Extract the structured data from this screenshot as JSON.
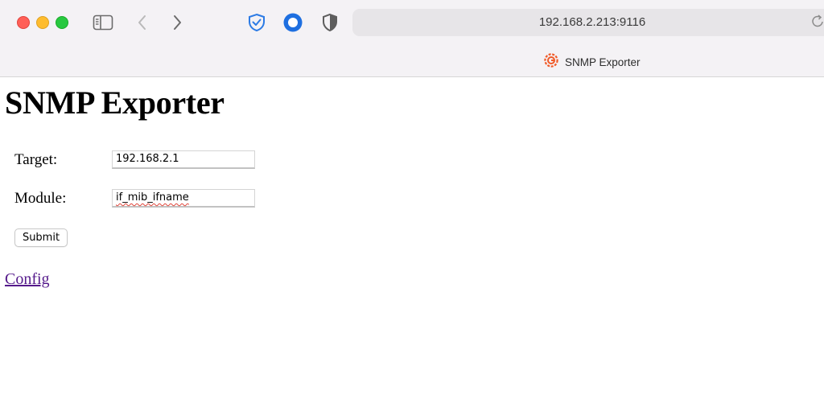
{
  "browser": {
    "url": "192.168.2.213:9116",
    "tab_title": "SNMP Exporter"
  },
  "page": {
    "title": "SNMP Exporter",
    "form": {
      "target_label": "Target:",
      "target_value": "192.168.2.1",
      "module_label": "Module:",
      "module_value": "if_mib_ifname",
      "submit_label": "Submit"
    },
    "config_link": "Config"
  },
  "colors": {
    "link_visited": "#551a8b",
    "grafana_icon": "#f05a28",
    "shield_blue": "#2c7be5"
  }
}
